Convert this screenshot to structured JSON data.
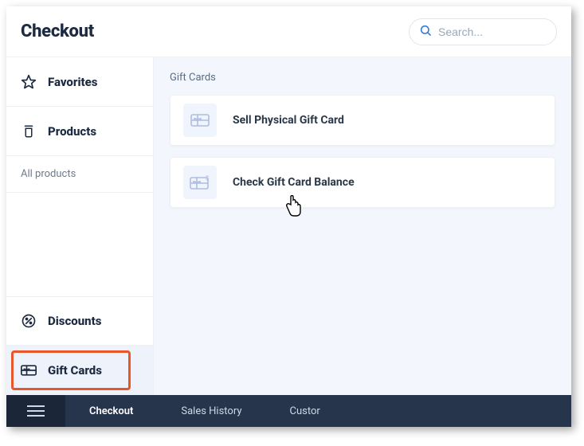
{
  "header": {
    "title": "Checkout",
    "search_placeholder": "Search..."
  },
  "sidebar": {
    "items": [
      {
        "label": "Favorites"
      },
      {
        "label": "Products"
      },
      {
        "label": "All products"
      },
      {
        "label": "Discounts"
      },
      {
        "label": "Gift Cards"
      }
    ]
  },
  "main": {
    "section_title": "Gift Cards",
    "cards": [
      {
        "label": "Sell Physical Gift Card"
      },
      {
        "label": "Check Gift Card Balance"
      }
    ]
  },
  "bottom_nav": {
    "items": [
      {
        "label": "Checkout"
      },
      {
        "label": "Sales History"
      },
      {
        "label": "Custor"
      }
    ]
  }
}
